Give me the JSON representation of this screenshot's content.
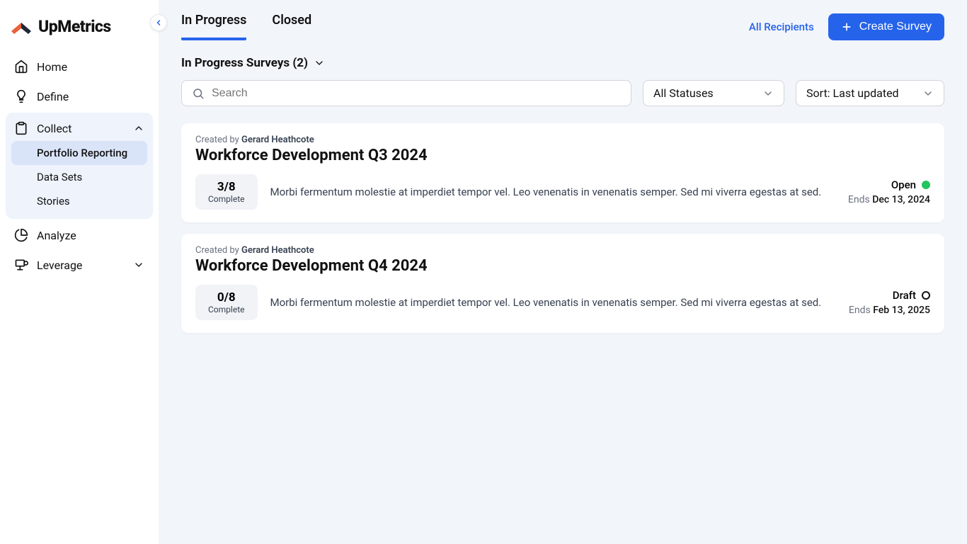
{
  "brand": {
    "name": "UpMetrics"
  },
  "sidebar": {
    "items": [
      {
        "label": "Home"
      },
      {
        "label": "Define"
      },
      {
        "label": "Collect",
        "expanded": true,
        "subitems": [
          {
            "label": "Portfolio Reporting",
            "active": true
          },
          {
            "label": "Data Sets"
          },
          {
            "label": "Stories"
          }
        ]
      },
      {
        "label": "Analyze"
      },
      {
        "label": "Leverage",
        "expandable": true
      }
    ]
  },
  "tabs": [
    {
      "label": "In Progress",
      "active": true
    },
    {
      "label": "Closed"
    }
  ],
  "actions": {
    "all_recipients": "All Recipients",
    "create_survey": "Create Survey"
  },
  "section": {
    "title": "In Progress Surveys (2)"
  },
  "filters": {
    "search_placeholder": "Search",
    "status_label": "All Statuses",
    "sort_label": "Sort: Last updated"
  },
  "surveys": [
    {
      "created_by_prefix": "Created by",
      "author": "Gerard Heathcote",
      "title": "Workforce Development Q3 2024",
      "progress": "3/8",
      "progress_label": "Complete",
      "description": "Morbi fermentum molestie at imperdiet tempor vel. Leo venenatis in venenatis semper. Sed mi viverra egestas at sed.",
      "status": "Open",
      "status_kind": "open",
      "ends_label": "Ends",
      "end_date": "Dec 13, 2024"
    },
    {
      "created_by_prefix": "Created by",
      "author": "Gerard Heathcote",
      "title": "Workforce Development Q4 2024",
      "progress": "0/8",
      "progress_label": "Complete",
      "description": "Morbi fermentum molestie at imperdiet tempor vel. Leo venenatis in venenatis semper. Sed mi viverra egestas at sed.",
      "status": "Draft",
      "status_kind": "draft",
      "ends_label": "Ends",
      "end_date": "Feb 13, 2025"
    }
  ]
}
